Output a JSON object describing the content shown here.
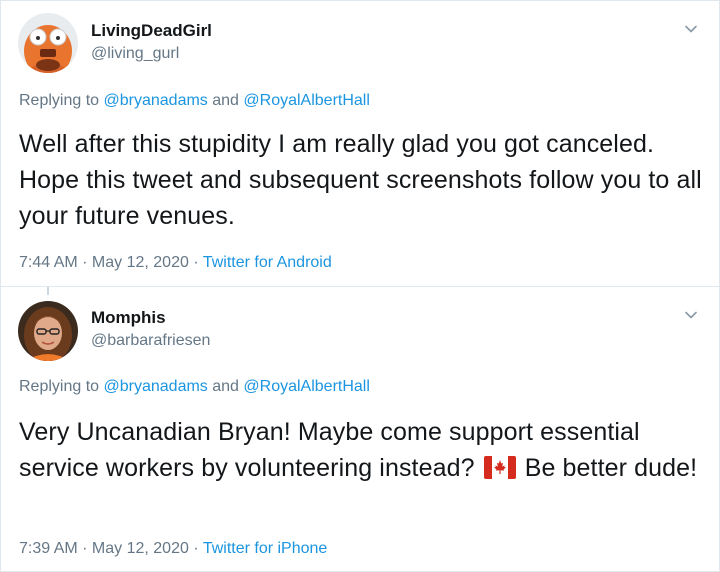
{
  "tweets": [
    {
      "display_name": "LivingDeadGirl",
      "handle": "@living_gurl",
      "replying_prefix": "Replying to ",
      "replying_to": [
        "@bryanadams",
        "@RoyalAlbertHall"
      ],
      "replying_joiner": " and ",
      "text": "Well after this stupidity I am really glad you got canceled. Hope this tweet and subsequent screenshots follow you to all your future venues.",
      "time": "7:44 AM",
      "separator": " · ",
      "date": "May 12, 2020",
      "source": "Twitter for Android",
      "avatar_icon": "muppet-avatar"
    },
    {
      "display_name": "Momphis",
      "handle": "@barbarafriesen",
      "replying_prefix": "Replying to ",
      "replying_to": [
        "@bryanadams",
        "@RoyalAlbertHall"
      ],
      "replying_joiner": " and ",
      "text_before_flag": "Very Uncanadian Bryan!  Maybe come support essential service workers by volunteering instead? ",
      "text_after_flag": " Be better dude!",
      "emoji_icon": "canada-flag-emoji",
      "time": "7:39 AM",
      "separator": " · ",
      "date": "May 12, 2020",
      "source": "Twitter for iPhone",
      "avatar_icon": "woman-avatar"
    }
  ],
  "colors": {
    "link": "#1b95e0",
    "secondary": "#657786",
    "text": "#14171a",
    "border": "#e1e8ed"
  },
  "icons": {
    "more": "chevron-down-icon"
  }
}
